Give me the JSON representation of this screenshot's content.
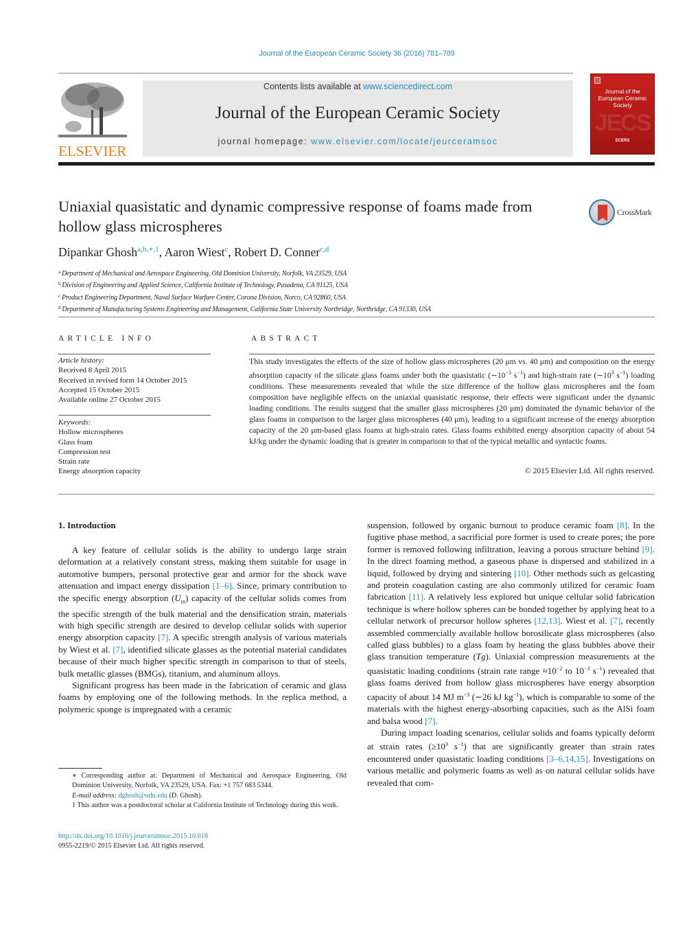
{
  "header": {
    "journal_reference": "Journal of the European Ceramic Society 36 (2016) 781–789",
    "contents_prefix": "Contents lists available at ",
    "contents_link": "www.sciencedirect.com",
    "journal_name": "Journal of the European Ceramic Society",
    "homepage_prefix": "journal homepage: ",
    "homepage_link": "www.elsevier.com/locate/jeurceramsoc",
    "publisher_logo_text": "ELSEVIER",
    "cover": {
      "title_line1": "Journal of the",
      "title_line2": "European Ceramic Society",
      "watermark": "JECS",
      "society": "ECERS"
    },
    "colors": {
      "link": "#2a8fb8",
      "elsevier_orange": "#ef7d21",
      "cover_red": "#c8201c"
    }
  },
  "article": {
    "title": "Uniaxial quasistatic and dynamic compressive response of foams made from hollow glass microspheres",
    "crossmark_label": "CrossMark",
    "authors": [
      {
        "name": "Dipankar Ghosh",
        "marks": "a,b,∗,1"
      },
      {
        "name": "Aaron Wiest",
        "marks": "c"
      },
      {
        "name": "Robert D. Conner",
        "marks": "c,d"
      }
    ],
    "affiliations": [
      {
        "mark": "a",
        "text": "Department of Mechanical and Aerospace Engineering, Old Dominion University, Norfolk, VA 23529, USA"
      },
      {
        "mark": "b",
        "text": "Division of Engineering and Applied Science, California Institute of Technology, Pasadena, CA 91125, USA"
      },
      {
        "mark": "c",
        "text": "Product Engineering Department, Naval Surface Warfare Center, Corona Division, Norco, CA 92860, USA"
      },
      {
        "mark": "d",
        "text": "Department of Manufacturing Systems Engineering and Management, California State University Northridge, Northridge, CA 91330, USA"
      }
    ]
  },
  "article_info": {
    "heading": "ARTICLE INFO",
    "history_label": "Article history:",
    "history": [
      "Received 8 April 2015",
      "Received in revised form 14 October 2015",
      "Accepted 15 October 2015",
      "Available online 27 October 2015"
    ],
    "keywords_label": "Keywords:",
    "keywords": [
      "Hollow microspheres",
      "Glass foam",
      "Compression test",
      "Strain rate",
      "Energy absorption capacity"
    ]
  },
  "abstract": {
    "heading": "ABSTRACT",
    "part1": "This study investigates the effects of the size of hollow glass microspheres (20 μm vs. 40 μm) and composition on the energy absorption capacity of the silicate glass foams under both the quasistatic (∼10",
    "exp1": "−3",
    "part2": " s",
    "exp2": "−1",
    "part3": ") and high-strain rate (∼10",
    "exp3": "3",
    "part4": " s",
    "exp4": "−1",
    "part5": ") loading conditions. These measurements revealed that while the size difference of the hollow glass microspheres and the foam composition have negligible effects on the uniaxial quasistatic response, their effects were significant under the dynamic loading conditions. The results suggest that the smaller glass microspheres (20 μm) dominated the dynamic behavior of the glass foams in comparison to the larger glass microspheres (40 μm), leading to a significant increase of the energy absorption capacity of the 20 μm-based glass foams at high-strain rates. Glass foams exhibited energy absorption capacity of about 54 kJ/kg under the dynamic loading that is greater in comparison to that of the typical metallic and syntactic foams.",
    "copyright": "© 2015 Elsevier Ltd. All rights reserved."
  },
  "introduction": {
    "heading": "1.  Introduction",
    "p1": {
      "a": "A key feature of cellular solids is the ability to undergo large strain deformation at a relatively constant stress, making them suitable for usage in automotive bumpers, personal protective gear and armor for the shock wave attenuation and impact energy dissipation ",
      "ref1": "[1–6]",
      "b": ". Since, primary contribution to the specific energy absorption (",
      "sym": "U",
      "sub": "m",
      "c": ") capacity of the cellular solids comes from the specific strength of the bulk material and the densification strain, materials with high specific strength are desired to develop cellular solids with superior energy absorption capacity ",
      "ref2": "[7]",
      "d": ". A specific strength analysis of various materials by Wiest et al. ",
      "ref3": "[7]",
      "e": ", identified silicate glasses as the potential material candidates because of their much higher specific strength in comparison to that of steels, bulk metallic glasses (BMGs), titanium, and aluminum alloys."
    },
    "p2": {
      "a": "Significant progress has been made in the fabrication of ceramic and glass foams by employing one of the following methods. In the replica method, a polymeric sponge is impregnated with a ceramic suspension, followed by organic burnout to produce ceramic foam ",
      "ref1": "[8]",
      "b": ". In the fugitive phase method, a sacrificial pore former is used to create pores; the pore former is removed following infiltration, leaving a porous structure behind ",
      "ref2": "[9]",
      "c": ". In the direct foaming method, a gaseous phase is dispersed and stabilized in a liquid, followed by drying and sintering ",
      "ref3": "[10]",
      "d": ". Other methods such as gelcasting and protein coagulation casting are also commonly utilized for ceramic foam fabrication ",
      "ref4": "[11]",
      "e": ". A relatively less explored but unique cellular solid fabrication technique is where hollow spheres can be bonded together by applying heat to a cellular network of precursor hollow spheres ",
      "ref5": "[12,13]",
      "f": ". Wiest et al. ",
      "ref6": "[7]",
      "g": ", recently assembled commercially available hollow borosilicate glass microspheres (also called glass bubbles) to a glass foam by heating the glass bubbles above their glass transition temperature (",
      "tg": "Tg",
      "h": "). Uniaxial compression measurements at the quasistatic loading conditions (strain rate range ≈10",
      "exp1": "−2",
      "i": " to 10",
      "exp2": "−3",
      "j": " s",
      "exp3": "−1",
      "k": ") revealed that glass foams derived from hollow glass microspheres have energy absorption capacity of about 14 MJ m",
      "exp4": "−3",
      "l": " (∼26 kJ kg",
      "exp5": "−1",
      "m": "), which is comparable to some of the materials with the highest energy-absorbing capacities, such as the AlSi foam and balsa wood ",
      "ref7": "[7]",
      "n": "."
    },
    "p3": {
      "a": "During impact loading scenarios, cellular solids and foams typically deform at strain rates (≥10",
      "exp1": "3",
      "b": " s",
      "exp2": "−1",
      "c": ") that are significantly greater than strain rates encountered under quasistatic loading conditions ",
      "ref1": "[3–6,14,15]",
      "d": ". Investigations on various metallic and polymeric foams as well as on natural cellular solids have revealed that com-"
    }
  },
  "footnotes": {
    "corresponding": "∗  Corresponding author at: Department of Mechanical and Aerospace Engineering, Old Dominion University, Norfolk, VA 23529, USA. Fax: +1 757 683 5344.",
    "email_label": "E-mail address: ",
    "email": "dghosh@odu.edu",
    "email_suffix": " (D. Ghosh).",
    "note1": "1  This author was a postdoctoral scholar at California Institute of Technology during this work.",
    "doi": "http://dx.doi.org/10.1016/j.jeurceramsoc.2015.10.018",
    "issn": "0955-2219/© 2015 Elsevier Ltd. All rights reserved."
  }
}
